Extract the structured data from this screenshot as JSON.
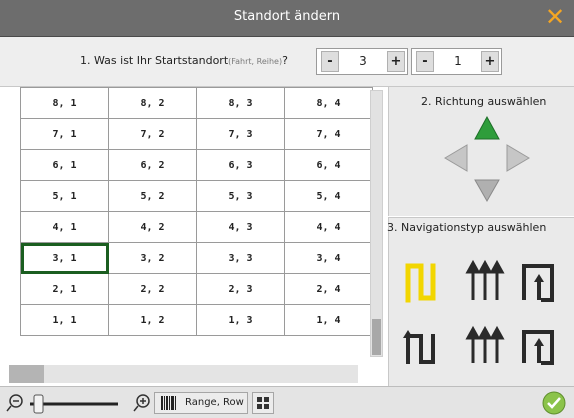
{
  "window": {
    "title": "Standort ändern",
    "close_icon": "close-icon",
    "accent": "#f5a623"
  },
  "start": {
    "question": "1. Was ist Ihr Startstandort",
    "hint": "(Fahrt, Reihe)",
    "question_mark": "?",
    "row_value": "3",
    "col_value": "1",
    "minus": "-",
    "plus": "+"
  },
  "grid": {
    "rows": [
      [
        "8, 1",
        "8, 2",
        "8, 3",
        "8, 4"
      ],
      [
        "7, 1",
        "7, 2",
        "7, 3",
        "7, 4"
      ],
      [
        "6, 1",
        "6, 2",
        "6, 3",
        "6, 4"
      ],
      [
        "5, 1",
        "5, 2",
        "5, 3",
        "5, 4"
      ],
      [
        "4, 1",
        "4, 2",
        "4, 3",
        "4, 4"
      ],
      [
        "3, 1",
        "3, 2",
        "3, 3",
        "3, 4"
      ],
      [
        "2, 1",
        "2, 2",
        "2, 3",
        "2, 4"
      ],
      [
        "1, 1",
        "1, 2",
        "1, 3",
        "1, 4"
      ]
    ],
    "selected": "3, 1",
    "selected_color": "#1b5e20"
  },
  "direction": {
    "label": "2. Richtung auswählen",
    "active_color": "#2e9d3b",
    "inactive_color": "#b0b0b0"
  },
  "navigation": {
    "label": "3. Navigationstyp auswählen",
    "selected_color": "#f2d600",
    "icon_color": "#2a2a2a"
  },
  "toolbar": {
    "range_label": "Range, Row",
    "zoom_out_icon": "zoom-out-icon",
    "zoom_in_icon": "zoom-in-icon",
    "barcode_icon": "barcode-icon",
    "map_icon": "map-icon",
    "confirm_color": "#8bc34a"
  }
}
